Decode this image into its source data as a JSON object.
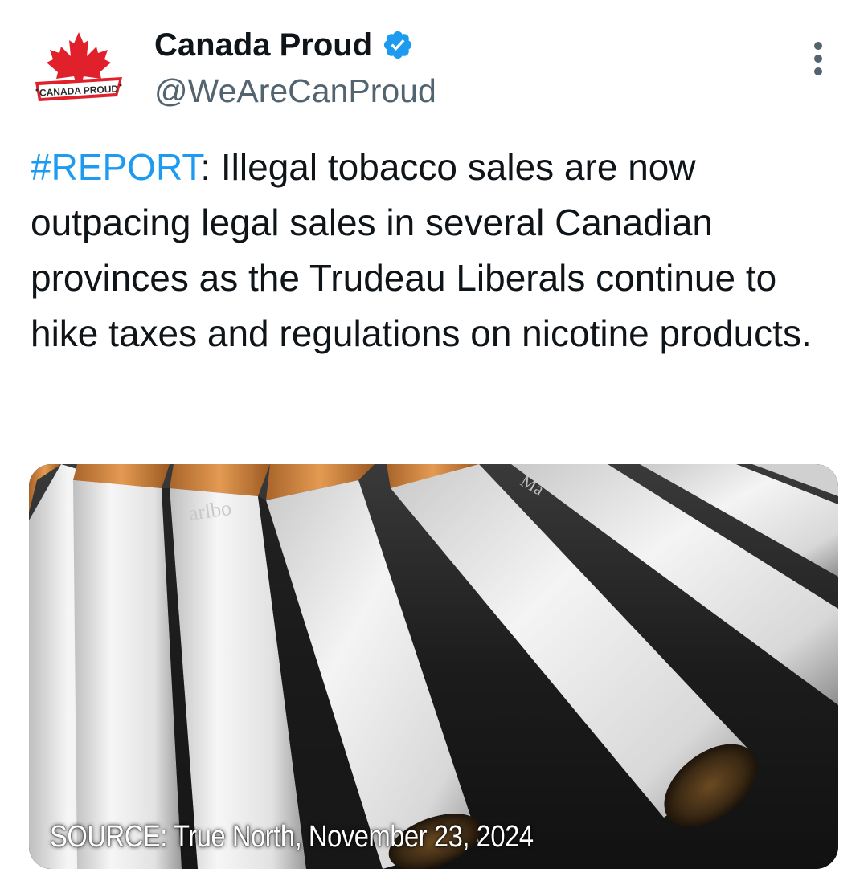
{
  "account": {
    "display_name": "Canada Proud",
    "handle": "@WeAreCanProud",
    "avatar_text": "CANADA PROUD",
    "verified": true,
    "verified_color": "#1d9bf0"
  },
  "tweet": {
    "hashtag": "#REPORT",
    "body": ": Illegal tobacco sales are now outpacing legal sales in several Canadian provinces as the Trudeau Liberals continue to hike taxes and regulations on nicotine products."
  },
  "media": {
    "caption": "SOURCE: True North, November 23, 2024",
    "brand_imprint_1": "arlbo",
    "brand_imprint_2": "Ma"
  },
  "colors": {
    "accent": "#1d9bf0",
    "text": "#0f1419",
    "secondary": "#536471",
    "logo_red": "#e0212c"
  },
  "icons": {
    "verified": "verified-badge-icon",
    "more": "more-options-icon"
  }
}
